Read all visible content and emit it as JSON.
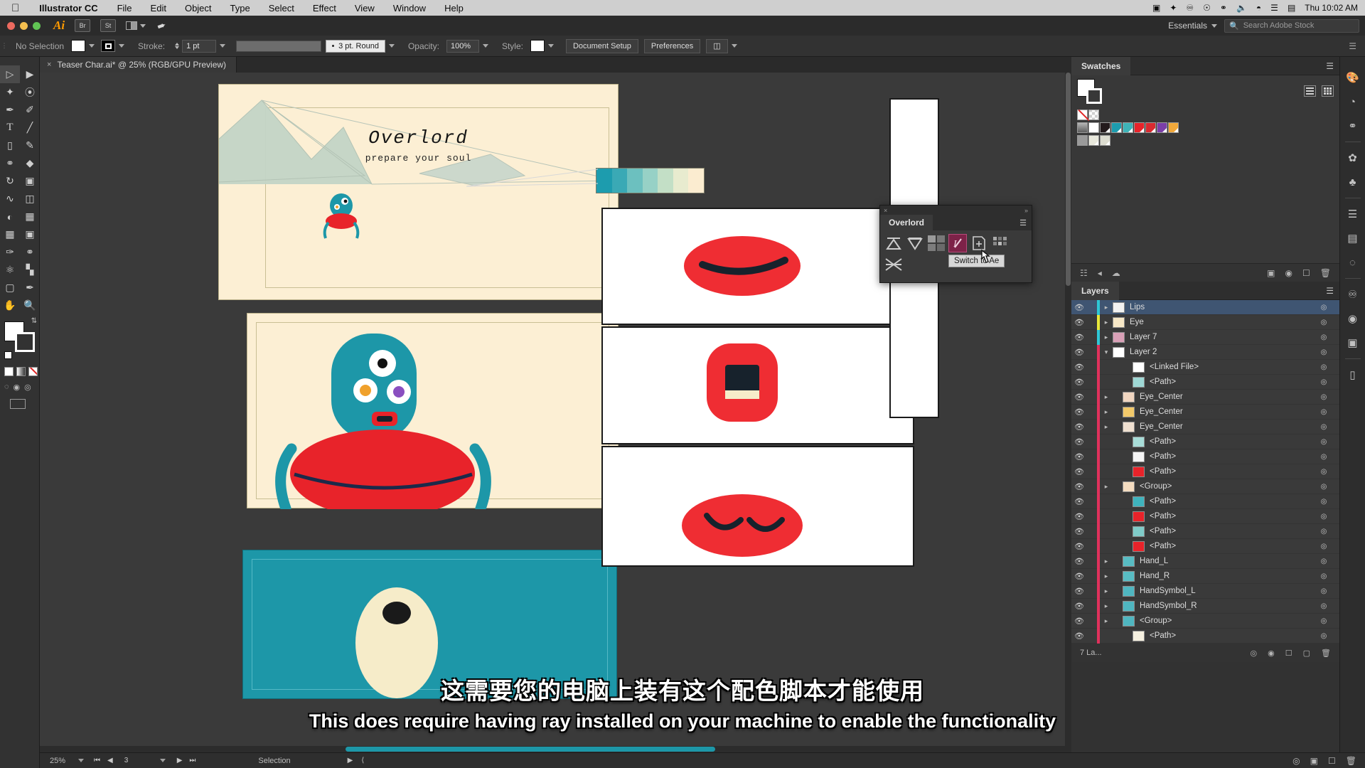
{
  "macbar": {
    "apple": "&#63743;",
    "app": "Illustrator CC",
    "menus": [
      "File",
      "Edit",
      "Object",
      "Type",
      "Select",
      "Effect",
      "View",
      "Window",
      "Help"
    ],
    "status_icons": [
      "screen-record-icon",
      "dropbox-icon",
      "creative-cloud-icon",
      "clock-icon",
      "bluetooth-icon",
      "volume-icon",
      "wifi-icon",
      "input-icon",
      "battery-icon"
    ],
    "clock": "Thu 10:02 AM"
  },
  "approw": {
    "ai_logo": "Ai",
    "bridge": "Br",
    "stock": "St",
    "arrange_label": "arrange-documents",
    "rocket": "&#10148;",
    "workspace": "Essentials",
    "search_placeholder": "Search Adobe Stock"
  },
  "control": {
    "selection_state": "No Selection",
    "fill_color": "#ffffff",
    "stroke_label": "Stroke:",
    "stroke_weight": "1 pt",
    "brush_profile": "3 pt. Round",
    "opacity_label": "Opacity:",
    "opacity_value": "100%",
    "style_label": "Style:",
    "document_setup": "Document Setup",
    "preferences": "Preferences"
  },
  "tab": {
    "close": "×",
    "title": "Teaser Char.ai* @ 25% (RGB/GPU Preview)"
  },
  "tools": [
    {
      "name": "selection-tool",
      "glyph": "selection",
      "selected": true
    },
    {
      "name": "direct-selection-tool",
      "glyph": "direct"
    },
    {
      "name": "magic-wand-tool",
      "glyph": "wand"
    },
    {
      "name": "lasso-tool",
      "glyph": "lasso"
    },
    {
      "name": "pen-tool",
      "glyph": "pen"
    },
    {
      "name": "curvature-tool",
      "glyph": "curvature"
    },
    {
      "name": "type-tool",
      "glyph": "T"
    },
    {
      "name": "line-segment-tool",
      "glyph": "line"
    },
    {
      "name": "rectangle-tool",
      "glyph": "rect"
    },
    {
      "name": "paintbrush-tool",
      "glyph": "brush"
    },
    {
      "name": "shaper-tool",
      "glyph": "shaper"
    },
    {
      "name": "eraser-tool",
      "glyph": "eraser"
    },
    {
      "name": "rotate-tool",
      "glyph": "rotate"
    },
    {
      "name": "scale-tool",
      "glyph": "scale"
    },
    {
      "name": "width-tool",
      "glyph": "width"
    },
    {
      "name": "free-transform-tool",
      "glyph": "transform"
    },
    {
      "name": "shape-builder-tool",
      "glyph": "builder"
    },
    {
      "name": "perspective-grid-tool",
      "glyph": "perspective"
    },
    {
      "name": "mesh-tool",
      "glyph": "mesh"
    },
    {
      "name": "gradient-tool",
      "glyph": "gradient"
    },
    {
      "name": "eyedropper-tool",
      "glyph": "eyedrop"
    },
    {
      "name": "blend-tool",
      "glyph": "blend"
    },
    {
      "name": "symbol-sprayer-tool",
      "glyph": "sprayer"
    },
    {
      "name": "column-graph-tool",
      "glyph": "graph"
    },
    {
      "name": "artboard-tool",
      "glyph": "artboard"
    },
    {
      "name": "slice-tool",
      "glyph": "slice"
    },
    {
      "name": "hand-tool",
      "glyph": "hand"
    },
    {
      "name": "zoom-tool",
      "glyph": "zoom"
    }
  ],
  "artwork": {
    "title": "Overlord",
    "subtitle": "prepare your soul",
    "palette": [
      "#1d9cae",
      "#3aa9b5",
      "#6cc0bf",
      "#97d1c6",
      "#c3dfc6",
      "#e8ebcf",
      "#fbecd0"
    ],
    "board1_bg": "#fcefd4",
    "board3_bg": "#1d97a8",
    "char_body": "#1d97a8",
    "char_shirt": "#e8232a"
  },
  "swatches_panel": {
    "title": "Swatches",
    "menu_icon": "panel-menu-icon",
    "list_view_icon": "list-view-icon",
    "grid_view_icon": "grid-view-icon",
    "row1": [
      "none",
      "registration"
    ],
    "row2": [
      "#808080",
      "#ffffff",
      "#231a1c",
      "#1d9cae",
      "#3eb4b8",
      "#e8232a",
      "#d82a30",
      "#7b3fa8",
      "#f2a93b"
    ],
    "row3": [
      "#9a9a9a",
      "#e8e8dc",
      "#dcdcd0"
    ]
  },
  "layers_panel": {
    "title": "Layers",
    "count_label": "7 La...",
    "toolbar_icons": [
      "locate-object-icon",
      "make-clipping-mask-icon",
      "collect-in-new-layer-icon",
      "release-to-layers-icon",
      "new-sublayer-icon",
      "new-layer-icon",
      "delete-layer-icon"
    ],
    "rows": [
      {
        "name": "Lips",
        "indent": 0,
        "color": "#2ec7d6",
        "expandable": true,
        "expanded": false,
        "selected": true,
        "thumb": "#f2f2f2"
      },
      {
        "name": "Eye",
        "indent": 0,
        "color": "#e8e83a",
        "expandable": true,
        "expanded": false,
        "selected": false,
        "thumb": "#f6e7c6"
      },
      {
        "name": "Layer 7",
        "indent": 0,
        "color": "#2ec7d6",
        "expandable": true,
        "expanded": false,
        "selected": false,
        "thumb": "#d9a0b7"
      },
      {
        "name": "Layer 2",
        "indent": 0,
        "color": "#e0315c",
        "expandable": true,
        "expanded": true,
        "selected": false,
        "thumb": "#ffffff"
      },
      {
        "name": "<Linked File>",
        "indent": 2,
        "color": "#e0315c",
        "expandable": false,
        "selected": false,
        "thumb": "#ffffff"
      },
      {
        "name": "<Path>",
        "indent": 2,
        "color": "#e0315c",
        "expandable": false,
        "selected": false,
        "thumb": "#9fd8d5"
      },
      {
        "name": "Eye_Center",
        "indent": 1,
        "color": "#e0315c",
        "expandable": true,
        "selected": false,
        "thumb": "#f0d5c0"
      },
      {
        "name": "Eye_Center",
        "indent": 1,
        "color": "#e0315c",
        "expandable": true,
        "selected": false,
        "thumb": "#f2c96a"
      },
      {
        "name": "Eye_Center",
        "indent": 1,
        "color": "#e0315c",
        "expandable": true,
        "selected": false,
        "thumb": "#f0e0d0"
      },
      {
        "name": "<Path>",
        "indent": 2,
        "color": "#e0315c",
        "expandable": false,
        "selected": false,
        "thumb": "#a8ddd8"
      },
      {
        "name": "<Path>",
        "indent": 2,
        "color": "#e0315c",
        "expandable": false,
        "selected": false,
        "thumb": "#f4f4f4"
      },
      {
        "name": "<Path>",
        "indent": 2,
        "color": "#e0315c",
        "expandable": false,
        "selected": false,
        "thumb": "#e8232a"
      },
      {
        "name": "<Group>",
        "indent": 1,
        "color": "#e0315c",
        "expandable": true,
        "selected": false,
        "thumb": "#f4dcc0"
      },
      {
        "name": "<Path>",
        "indent": 2,
        "color": "#e0315c",
        "expandable": false,
        "selected": false,
        "thumb": "#3fb3bd"
      },
      {
        "name": "<Path>",
        "indent": 2,
        "color": "#e0315c",
        "expandable": false,
        "selected": false,
        "thumb": "#e8232a"
      },
      {
        "name": "<Path>",
        "indent": 2,
        "color": "#e0315c",
        "expandable": false,
        "selected": false,
        "thumb": "#7fcbc8"
      },
      {
        "name": "<Path>",
        "indent": 2,
        "color": "#e0315c",
        "expandable": false,
        "selected": false,
        "thumb": "#e8232a"
      },
      {
        "name": "Hand_L",
        "indent": 1,
        "color": "#e0315c",
        "expandable": true,
        "selected": false,
        "thumb": "#58bcc3"
      },
      {
        "name": "Hand_R",
        "indent": 1,
        "color": "#e0315c",
        "expandable": true,
        "selected": false,
        "thumb": "#58bcc3"
      },
      {
        "name": "HandSymbol_L",
        "indent": 1,
        "color": "#e0315c",
        "expandable": true,
        "selected": false,
        "thumb": "#4fb6c0"
      },
      {
        "name": "HandSymbol_R",
        "indent": 1,
        "color": "#e0315c",
        "expandable": true,
        "selected": false,
        "thumb": "#4fb6c0"
      },
      {
        "name": "<Group>",
        "indent": 1,
        "color": "#e0315c",
        "expandable": true,
        "selected": false,
        "thumb": "#4fb6c0"
      },
      {
        "name": "<Path>",
        "indent": 2,
        "color": "#e0315c",
        "expandable": false,
        "selected": false,
        "thumb": "#f6f0e0"
      }
    ]
  },
  "overlord_panel": {
    "close": "×",
    "collapse": "»",
    "title": "Overlord",
    "menu_icon": "panel-menu-icon",
    "buttons": [
      {
        "name": "align-up-button"
      },
      {
        "name": "align-down-button"
      },
      {
        "name": "effects-grid-button"
      },
      {
        "name": "switch-to-ae-button",
        "active": true
      },
      {
        "name": "new-document-button"
      },
      {
        "name": "pixel-grid-button"
      },
      {
        "name": "cross-lines-button"
      }
    ],
    "tooltip": "Switch to Ae"
  },
  "right_dock_icons": [
    "color-icon",
    "color-guide-icon",
    "graphic-styles-icon",
    "brushes-icon",
    "symbols-icon",
    "align-icon",
    "gradient-icon",
    "transparency-icon",
    "creative-cloud-icon",
    "libraries-icon",
    "artboards-icon",
    "layers-dock-icon"
  ],
  "subtitles": {
    "chinese": "这需要您的电脑上装有这个配色脚本才能使用",
    "english": "This does require having ray installed on your machine to enable the functionality"
  },
  "statusbar": {
    "zoom": "25%",
    "page": "3",
    "tool": "Selection",
    "first_icon": "first-page-icon",
    "prev_icon": "prev-page-icon",
    "next_icon": "next-page-icon",
    "last_icon": "last-page-icon"
  }
}
